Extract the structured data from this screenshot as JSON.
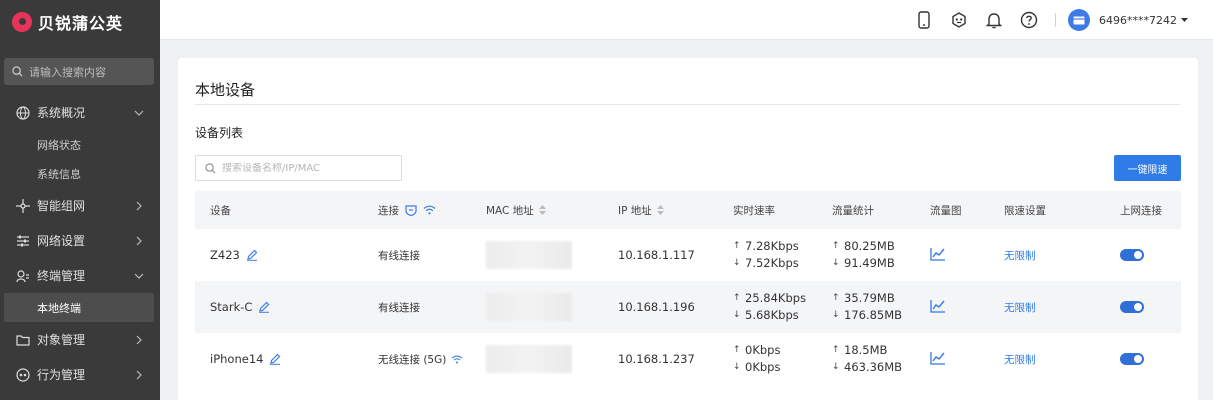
{
  "app": {
    "brand": "贝锐蒲公英"
  },
  "sidebar": {
    "search_placeholder": "请输入搜索内容",
    "items": [
      {
        "label": "系统概况",
        "icon": "globe-icon",
        "expanded": true
      },
      {
        "label": "网络状态"
      },
      {
        "label": "系统信息"
      },
      {
        "label": "智能组网",
        "icon": "network-icon",
        "expanded": false
      },
      {
        "label": "网络设置",
        "icon": "sliders-icon",
        "expanded": false
      },
      {
        "label": "终端管理",
        "icon": "terminal-icon",
        "expanded": true
      },
      {
        "label": "本地终端",
        "active": true
      },
      {
        "label": "对象管理",
        "icon": "folder-icon",
        "expanded": false
      },
      {
        "label": "行为管理",
        "icon": "behavior-icon",
        "expanded": false
      }
    ]
  },
  "header": {
    "username": "6496****7242",
    "icons": [
      "phone-icon",
      "robot-icon",
      "bell-icon",
      "help-icon"
    ]
  },
  "main": {
    "title": "本地设备",
    "section_title": "设备列表",
    "search_placeholder": "搜索设备名称/IP/MAC",
    "limit_button": "一键限速",
    "columns": [
      "设备",
      "连接",
      "MAC 地址",
      "IP 地址",
      "实时速率",
      "流量统计",
      "流量图",
      "限速设置",
      "上网连接"
    ],
    "rows": [
      {
        "name": "Z423",
        "connection": "有线连接",
        "ip": "10.168.1.117",
        "up_rate": "7.28Kbps",
        "down_rate": "7.52Kbps",
        "up_traffic": "80.25MB",
        "down_traffic": "91.49MB",
        "limit": "无限制",
        "online": true
      },
      {
        "name": "Stark-C",
        "connection": "有线连接",
        "ip": "10.168.1.196",
        "up_rate": "25.84Kbps",
        "down_rate": "5.68Kbps",
        "up_traffic": "35.79MB",
        "down_traffic": "176.85MB",
        "limit": "无限制",
        "online": true
      },
      {
        "name": "iPhone14",
        "connection": "无线连接 (5G)",
        "ip": "10.168.1.237",
        "up_rate": "0Kbps",
        "down_rate": "0Kbps",
        "up_traffic": "18.5MB",
        "down_traffic": "463.36MB",
        "limit": "无限制",
        "online": true
      }
    ]
  },
  "colors": {
    "accent": "#2f7be8",
    "sidebar_bg": "#3a3a3a",
    "brand": "#e8345a"
  }
}
